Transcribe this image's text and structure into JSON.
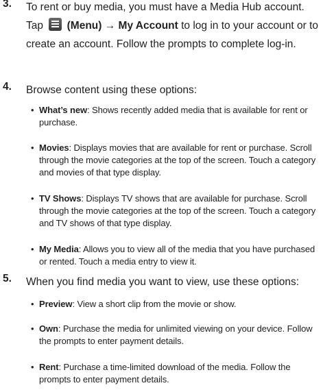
{
  "steps": [
    {
      "number": "3.",
      "pre": "To rent or buy media, you must have a Media Hub account. Tap",
      "icon": "menu-icon",
      "menu_label": "(Menu)",
      "arrow": "→",
      "my_account": "My Account",
      "post": "to log in to your account or to create an account. Follow the prompts to complete log-in."
    },
    {
      "number": "4.",
      "text": "Browse content using these options:",
      "bullets": [
        {
          "term": "What’s new",
          "desc": ": Shows recently added media that is available for rent or purchase."
        },
        {
          "term": "Movies",
          "desc": ": Displays movies that are available for rent or purchase. Scroll through the movie categories at the top of the screen. Touch a category and movies of that type display."
        },
        {
          "term": "TV Shows",
          "desc": ": Displays TV shows that are available for purchase. Scroll through the movie categories at the top of the screen. Touch a category and TV shows of that type display."
        },
        {
          "term": "My Media",
          "desc": ": Allows you to view all of the media that you have purchased or rented. Touch a media entry to view it."
        }
      ]
    },
    {
      "number": "5.",
      "text": "When you find media you want to view, use these options:",
      "bullets": [
        {
          "term": "Preview",
          "desc": ": View a short clip from the movie or show."
        },
        {
          "term": "Own",
          "desc": ": Purchase the media for unlimited viewing on your device. Follow the prompts to enter payment details."
        },
        {
          "term": "Rent",
          "desc": ": Purchase a time-limited download of the media. Follow the prompts to enter payment details."
        }
      ]
    }
  ]
}
